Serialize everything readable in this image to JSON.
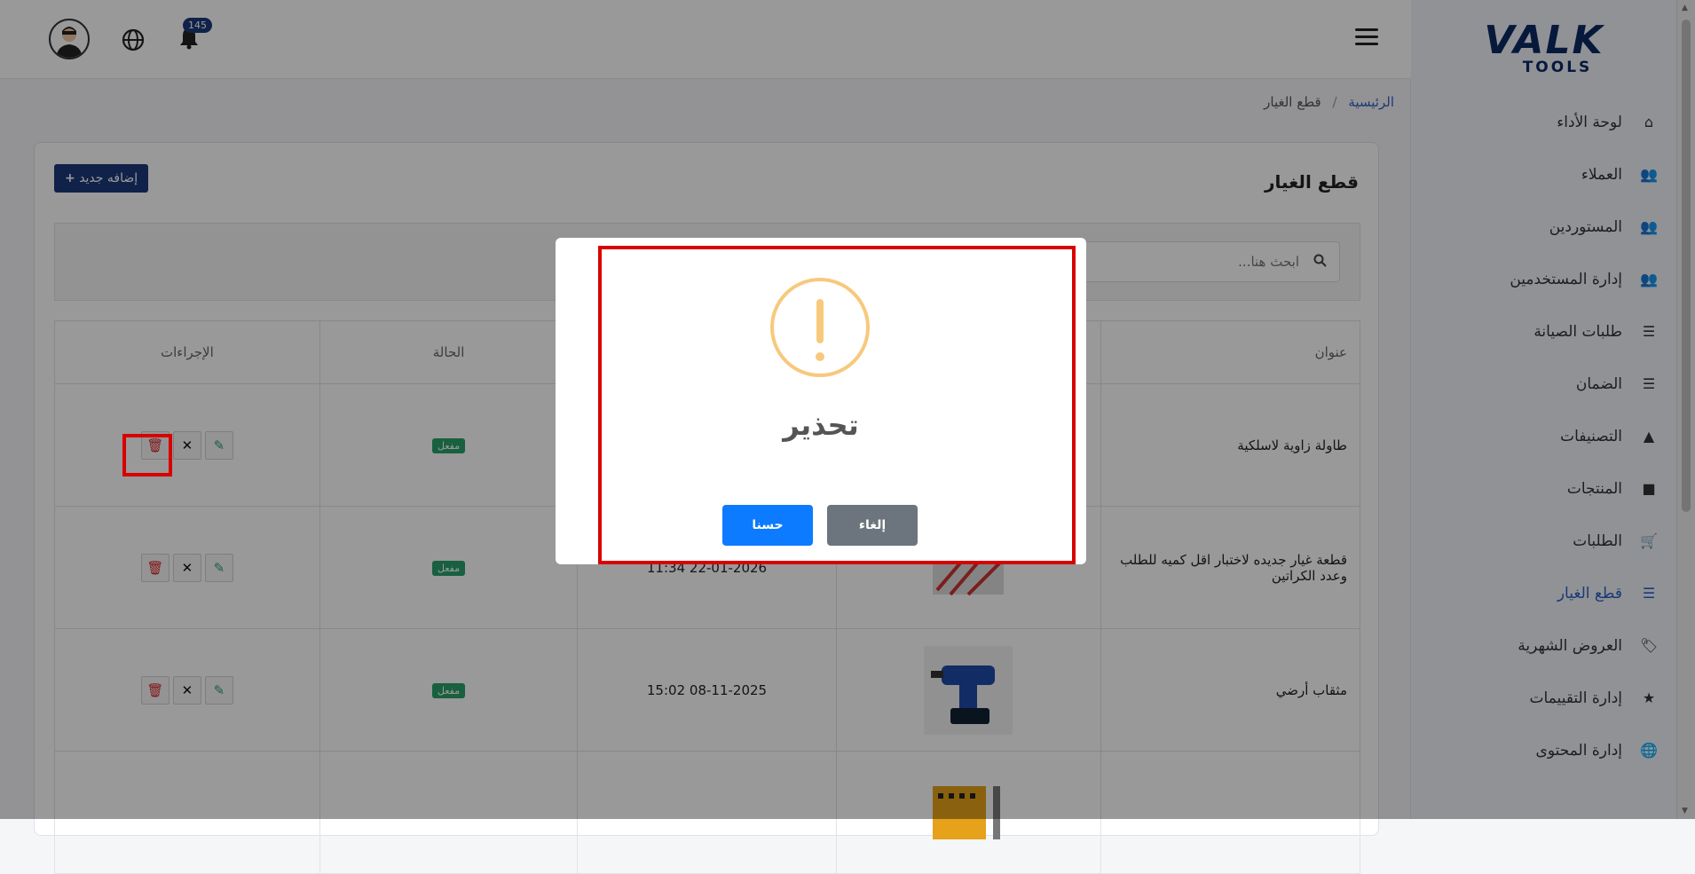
{
  "header": {
    "notification_count": "145"
  },
  "sidebar": {
    "logo_main": "VALK",
    "logo_sub": "TOOLS",
    "items": [
      {
        "label": "لوحة الأداء",
        "icon": "home-icon",
        "glyph": "⌂"
      },
      {
        "label": "العملاء",
        "icon": "users-icon",
        "glyph": "👥"
      },
      {
        "label": "المستوردين",
        "icon": "users-icon",
        "glyph": "👥"
      },
      {
        "label": "إدارة المستخدمين",
        "icon": "users-icon",
        "glyph": "👥"
      },
      {
        "label": "طلبات الصيانة",
        "icon": "list-icon",
        "glyph": "☰"
      },
      {
        "label": "الضمان",
        "icon": "list-icon",
        "glyph": "☰"
      },
      {
        "label": "التصنيفات",
        "icon": "shapes-icon",
        "glyph": "▲"
      },
      {
        "label": "المنتجات",
        "icon": "box-icon",
        "glyph": "■"
      },
      {
        "label": "الطلبات",
        "icon": "cart-icon",
        "glyph": "🛒"
      },
      {
        "label": "قطع الغيار",
        "icon": "list-icon",
        "glyph": "☰"
      },
      {
        "label": "العروض الشهرية",
        "icon": "tag-icon",
        "glyph": "🏷"
      },
      {
        "label": "إدارة التقييمات",
        "icon": "star-icon",
        "glyph": "★"
      },
      {
        "label": "إدارة المحتوى",
        "icon": "globe-icon",
        "glyph": "🌐"
      }
    ]
  },
  "breadcrumb": {
    "home": "الرئيسية",
    "sep": "/",
    "current": "قطع الغيار"
  },
  "page": {
    "title": "قطع الغيار",
    "add_button": "إضافه جديد",
    "add_glyph": "+"
  },
  "search": {
    "placeholder": "ابحث هنا..."
  },
  "table": {
    "headers": {
      "title": "عنوان",
      "status": "الحالة",
      "actions": "الإجراءات"
    },
    "rows": [
      {
        "title": "طاولة زاوية لاسلكية",
        "date": "",
        "status": "مفعل"
      },
      {
        "title": "قطعة غيار جديده لاختبار اقل كميه للطلب وعدد الكراتين",
        "date": "22-01-2026 11:34",
        "status": "مفعل"
      },
      {
        "title": "مثقاب أرضي",
        "date": "08-11-2025 15:02",
        "status": "مفعل"
      },
      {
        "title": "",
        "date": "",
        "status": ""
      }
    ]
  },
  "modal": {
    "title": "تحذير",
    "ok": "حسنا",
    "cancel": "إلغاء"
  },
  "colors": {
    "primary": "#1c3a7a",
    "active": "#2f5fc4",
    "success": "#28a06a",
    "danger": "#d9262a",
    "warning": "#f7c97d",
    "ok_button": "#0d7bff",
    "cancel_button": "#6c757d",
    "highlight": "#d90000"
  }
}
